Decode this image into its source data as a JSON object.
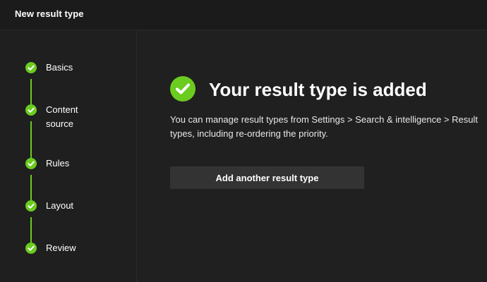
{
  "header": {
    "title": "New result type"
  },
  "steps": [
    {
      "label": "Basics",
      "icon": "checkmark-circle-icon"
    },
    {
      "label": "Content\nsource",
      "icon": "checkmark-circle-icon"
    },
    {
      "label": "Rules",
      "icon": "checkmark-circle-icon"
    },
    {
      "label": "Layout",
      "icon": "checkmark-circle-icon"
    },
    {
      "label": "Review",
      "icon": "checkmark-circle-icon"
    }
  ],
  "main": {
    "title": "Your result type is added",
    "description": "You can manage result types from Settings > Search & intelligence > Result types, including re-ordering the priority.",
    "add_button_label": "Add another result type",
    "success_icon": "checkmark-circle-icon"
  },
  "colors": {
    "accent": "#6bcb1f",
    "background": "#202020",
    "header_background": "#1b1b1b",
    "button_background": "#333333"
  }
}
